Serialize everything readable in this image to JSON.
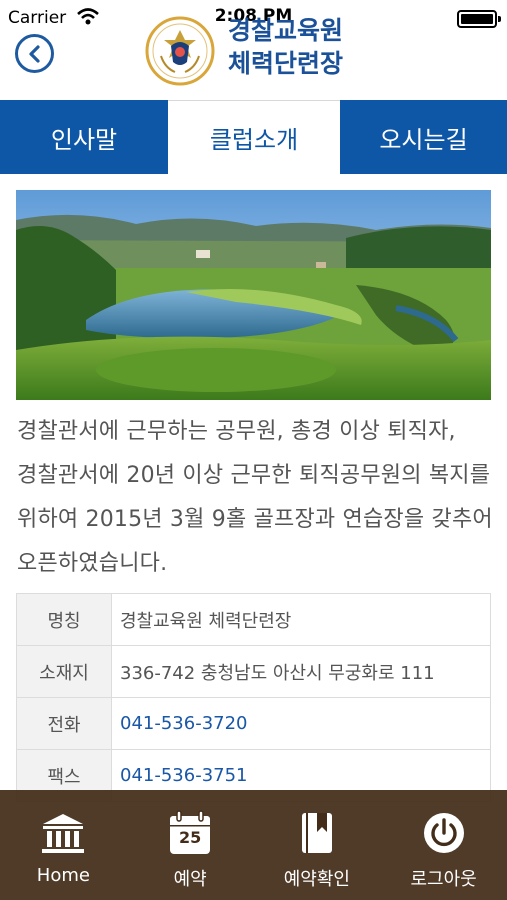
{
  "status_bar": {
    "carrier": "Carrier",
    "time": "2:08 PM"
  },
  "header": {
    "title_line1": "경찰교육원",
    "title_line2": "체력단련장"
  },
  "tabs": [
    {
      "label": "인사말",
      "active": false
    },
    {
      "label": "클럽소개",
      "active": true
    },
    {
      "label": "오시는길",
      "active": false
    }
  ],
  "intro": "경찰관서에 근무하는 공무원, 총경 이상 퇴직자, 경찰관서에 20년 이상 근무한 퇴직공무원의 복지를 위하여 2015년 3월 9홀 골프장과 연습장을 갖추어 오픈하였습니다.",
  "info_table": [
    {
      "key": "명칭",
      "value": "경찰교육원 체력단련장"
    },
    {
      "key": "소재지",
      "value": "336-742 충청남도 아산시 무궁화로 111"
    },
    {
      "key": "전화",
      "value": "041-536-3720"
    },
    {
      "key": "팩스",
      "value": "041-536-3751"
    }
  ],
  "bottom_nav": [
    {
      "label": "Home",
      "icon": "bank-icon"
    },
    {
      "label": "예약",
      "icon": "calendar-icon",
      "calendar_day": "25"
    },
    {
      "label": "예약확인",
      "icon": "bookmark-book-icon"
    },
    {
      "label": "로그아웃",
      "icon": "power-icon"
    }
  ],
  "colors": {
    "primary": "#0e56a6",
    "nav_bg": "#432c19",
    "title": "#1b5198"
  }
}
